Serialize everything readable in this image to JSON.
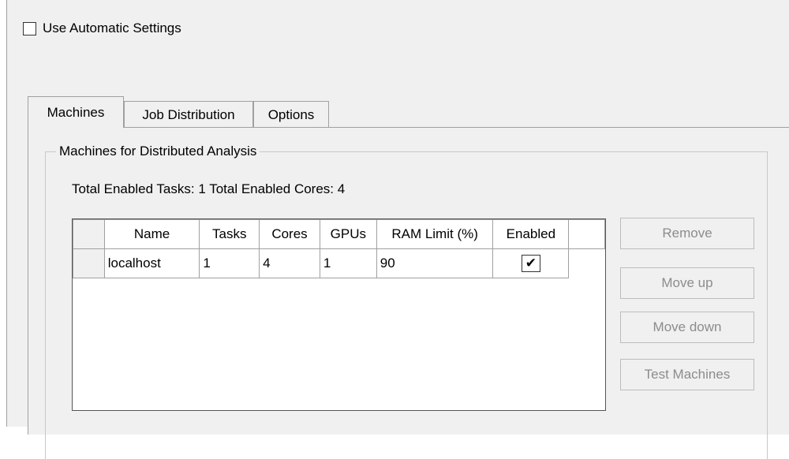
{
  "auto_settings": {
    "label": "Use Automatic Settings",
    "checked": false
  },
  "tabs": [
    {
      "label": "Machines",
      "active": true
    },
    {
      "label": "Job Distribution",
      "active": false
    },
    {
      "label": "Options",
      "active": false
    }
  ],
  "group": {
    "title": "Machines for Distributed Analysis",
    "totals": "Total Enabled Tasks: 1  Total Enabled Cores: 4"
  },
  "grid": {
    "columns": [
      "Name",
      "Tasks",
      "Cores",
      "GPUs",
      "RAM Limit (%)",
      "Enabled"
    ],
    "rows": [
      {
        "name": "localhost",
        "tasks": "1",
        "cores": "4",
        "gpus": "1",
        "ram": "90",
        "enabled": true
      }
    ]
  },
  "buttons": {
    "remove": "Remove",
    "move_up": "Move up",
    "move_down": "Move down",
    "test": "Test Machines"
  },
  "checkmark_glyph": "✔"
}
